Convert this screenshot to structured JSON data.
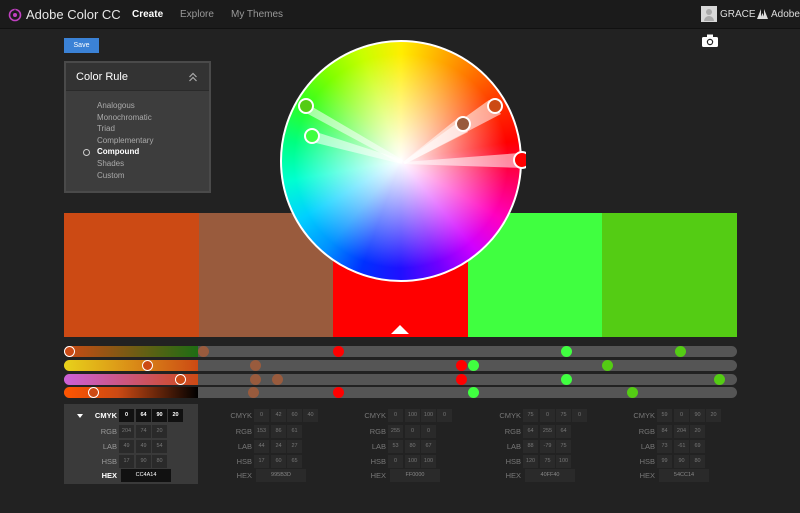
{
  "app": {
    "title": "Adobe Color CC"
  },
  "nav": [
    {
      "label": "Create",
      "active": true
    },
    {
      "label": "Explore",
      "active": false
    },
    {
      "label": "My Themes",
      "active": false
    }
  ],
  "user": {
    "name": "GRACE"
  },
  "adobe": {
    "label": "Adobe"
  },
  "toolbar": {
    "save_label": "Save"
  },
  "color_rule": {
    "title": "Color Rule",
    "items": [
      "Analogous",
      "Monochromatic",
      "Triad",
      "Complementary",
      "Compound",
      "Shades",
      "Custom"
    ],
    "selected": "Compound"
  },
  "swatches": [
    {
      "hex": "#CC4A14",
      "hex_label": "CC4A14",
      "cmyk": [
        "0",
        "64",
        "90",
        "20"
      ],
      "rgb": [
        "204",
        "74",
        "20"
      ],
      "lab": [
        "49",
        "49",
        "54"
      ],
      "hsb": [
        "17",
        "90",
        "80"
      ]
    },
    {
      "hex": "#995B3D",
      "hex_label": "995B3D",
      "cmyk": [
        "0",
        "42",
        "60",
        "40"
      ],
      "rgb": [
        "153",
        "86",
        "61"
      ],
      "lab": [
        "44",
        "24",
        "27"
      ],
      "hsb": [
        "17",
        "60",
        "65"
      ]
    },
    {
      "hex": "#FF0000",
      "hex_label": "FF0000",
      "cmyk": [
        "0",
        "100",
        "100",
        "0"
      ],
      "rgb": [
        "255",
        "0",
        "0"
      ],
      "lab": [
        "53",
        "80",
        "67"
      ],
      "hsb": [
        "0",
        "100",
        "100"
      ]
    },
    {
      "hex": "#40FF40",
      "hex_label": "40FF40",
      "cmyk": [
        "75",
        "0",
        "75",
        "0"
      ],
      "rgb": [
        "64",
        "255",
        "64"
      ],
      "lab": [
        "88",
        "-79",
        "75"
      ],
      "hsb": [
        "120",
        "75",
        "100"
      ]
    },
    {
      "hex": "#54CC14",
      "hex_label": "54CC14",
      "cmyk": [
        "59",
        "0",
        "90",
        "20"
      ],
      "rgb": [
        "84",
        "204",
        "20"
      ],
      "lab": [
        "73",
        "-61",
        "69"
      ],
      "hsb": [
        "99",
        "90",
        "80"
      ]
    }
  ],
  "value_labels": {
    "cmyk": "CMYK",
    "rgb": "RGB",
    "lab": "LAB",
    "hsb": "HSB",
    "hex": "HEX"
  },
  "active_swatch": 0,
  "icons": {
    "logo": "adobe-color-logo-icon",
    "camera": "camera-icon",
    "collapse": "chevron-double-up-icon",
    "adobe": "adobe-logo-icon"
  },
  "colors": {
    "accent": "#3B82D6",
    "background": "#222222"
  }
}
